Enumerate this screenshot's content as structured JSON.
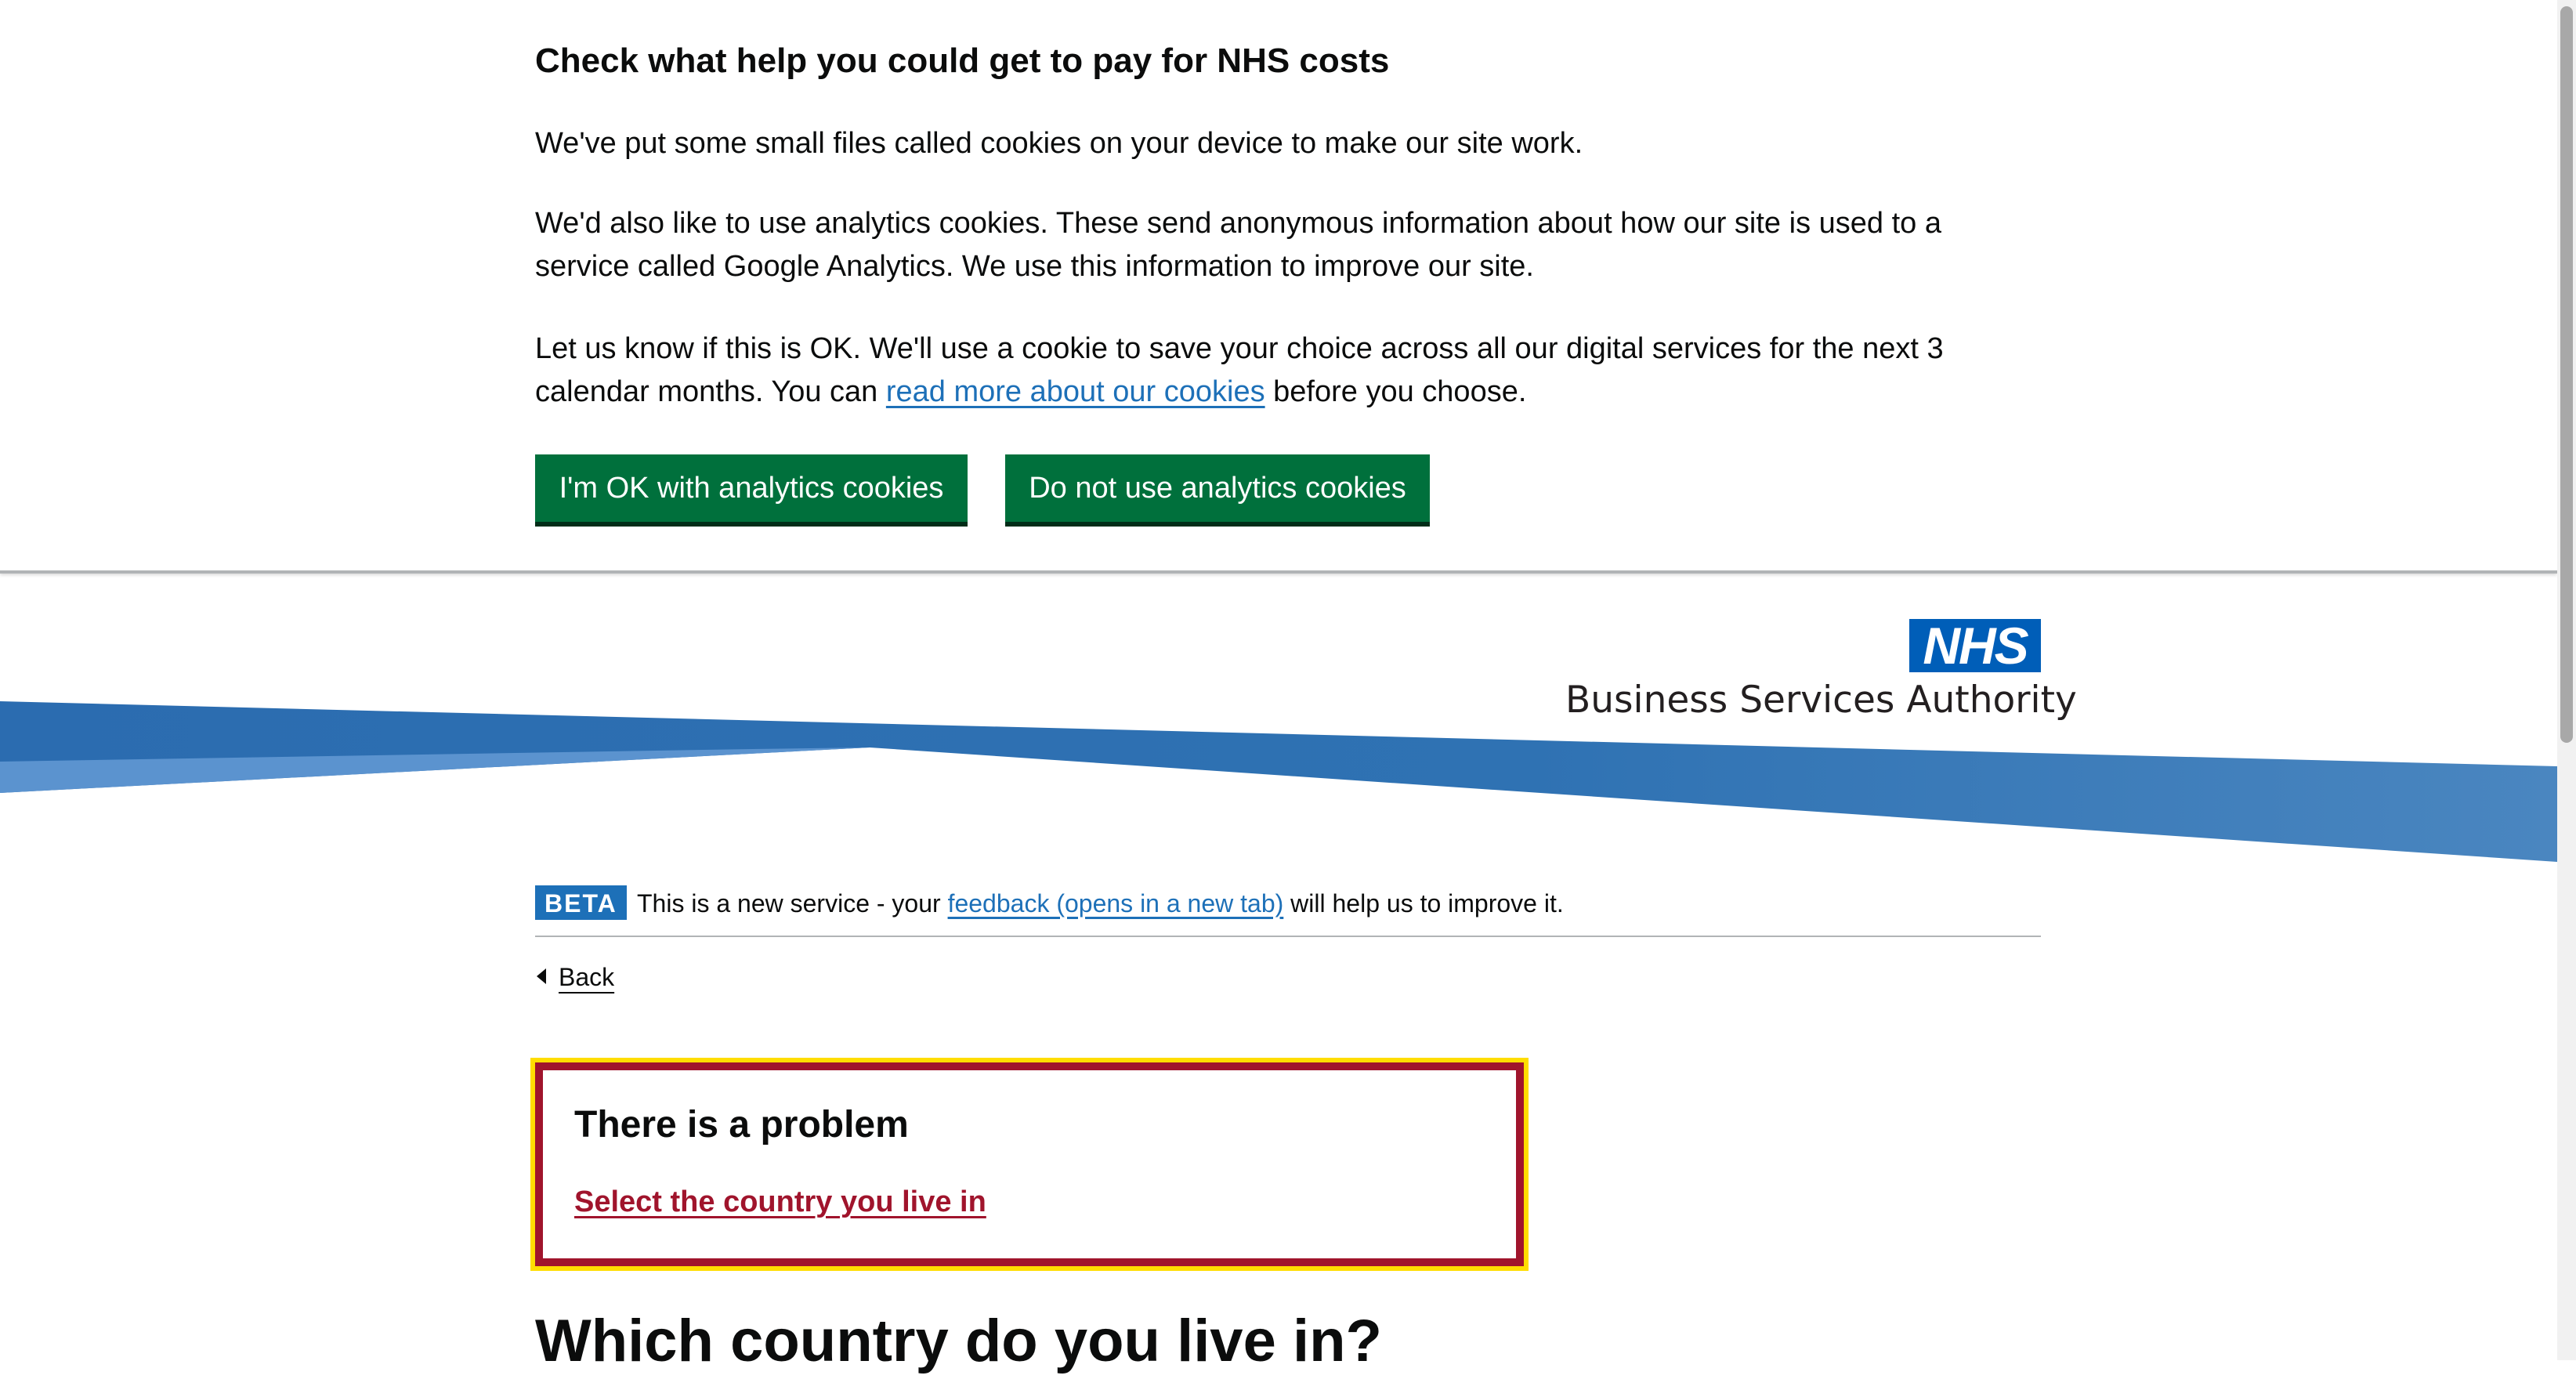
{
  "cookie_banner": {
    "title": "Check what help you could get to pay for NHS costs",
    "p1": "We've put some small files called cookies on your device to make our site work.",
    "p2": "We'd also like to use analytics cookies. These send anonymous information about how our site is used to a service called Google Analytics. We use this information to improve our site.",
    "p3_before": "Let us know if this is OK. We'll use a cookie to save your choice across all our digital services for the next 3 calendar months. You can ",
    "p3_link": "read more about our cookies",
    "p3_after": " before you choose.",
    "accept_label": "I'm OK with analytics cookies",
    "reject_label": "Do not use analytics cookies"
  },
  "header": {
    "logo_text": "NHS",
    "org_name": "Business Services Authority"
  },
  "phase_banner": {
    "tag": "BETA",
    "text_before": "This is a new service - your ",
    "link": "feedback (opens in a new tab)",
    "text_after": " will help us to improve it."
  },
  "back_link": "Back",
  "error_summary": {
    "title": "There is a problem",
    "error_link": "Select the country you live in"
  },
  "page_heading": "Which country do you live in?",
  "colors": {
    "button_green": "#00703c",
    "link_blue": "#1d70b8",
    "nhs_blue": "#005eb8",
    "error_red": "#a0142c",
    "focus_yellow": "#ffdd00"
  }
}
